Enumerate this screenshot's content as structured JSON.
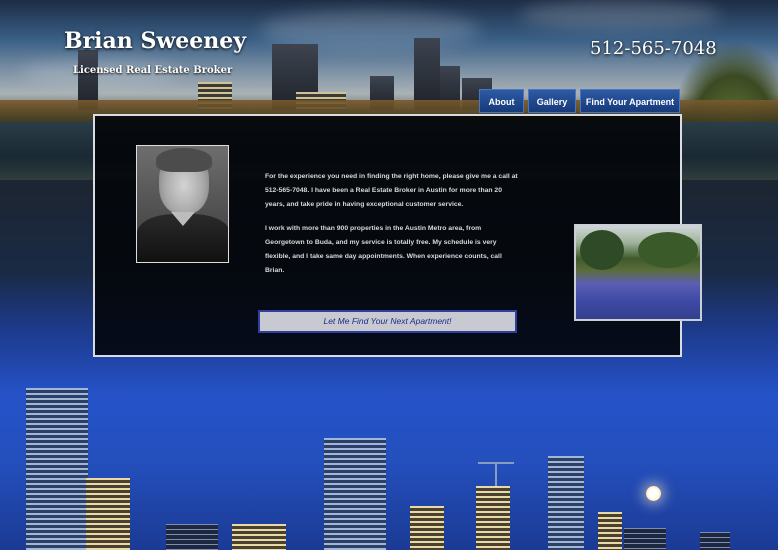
{
  "header": {
    "site_title": "Brian Sweeney",
    "subtitle": "Licensed Real Estate Broker",
    "phone": "512-565-7048"
  },
  "nav": {
    "items": [
      {
        "label": "About"
      },
      {
        "label": "Gallery"
      },
      {
        "label": "Find Your Apartment"
      }
    ]
  },
  "content": {
    "bio_paragraphs": [
      "For the experience you need in finding the right home, please give me a call at 512-565-7048. I have been a Real Estate Broker in Austin for more than 20 years, and take pride in having exceptional customer service.",
      "I work with more than 900 properties in the Austin Metro area, from Georgetown to Buda, and my service is totally free. My schedule is very flexible, and I take same day appointments. When experience counts, call Brian."
    ],
    "cta_label": "Let Me Find Your Next Apartment!"
  },
  "colors": {
    "nav_blue": "#1f4a93",
    "cta_text": "#1d2b8a",
    "panel_border": "#d8dde3"
  }
}
